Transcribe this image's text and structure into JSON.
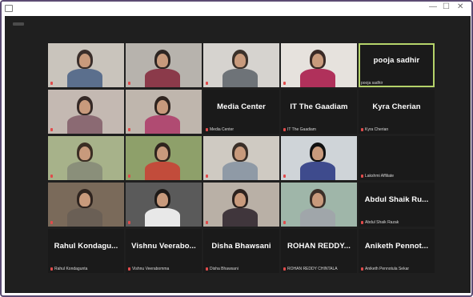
{
  "window": {
    "title": "",
    "controls": [
      "—",
      "☐",
      "✕"
    ],
    "accent": "#5b4a72",
    "background": "#1f1f1f"
  },
  "participants": [
    {
      "name": "",
      "label": "",
      "video": true,
      "muted": true
    },
    {
      "name": "",
      "label": "",
      "video": true,
      "muted": true
    },
    {
      "name": "",
      "label": "",
      "video": true,
      "muted": true
    },
    {
      "name": "",
      "label": "",
      "video": true,
      "muted": true
    },
    {
      "name": "pooja sadhir",
      "label": "pooja sadhir",
      "video": false,
      "muted": false,
      "active": true
    },
    {
      "name": "",
      "label": "",
      "video": true,
      "muted": true
    },
    {
      "name": "",
      "label": "",
      "video": true,
      "muted": true
    },
    {
      "name": "Media Center",
      "label": "Media Center",
      "video": false,
      "muted": true
    },
    {
      "name": "IT The Gaadiam",
      "label": "IT The Gaadiam",
      "video": false,
      "muted": true
    },
    {
      "name": "Kyra Cherian",
      "label": "Kyra Cherian",
      "video": false,
      "muted": true
    },
    {
      "name": "",
      "label": "",
      "video": true,
      "muted": true
    },
    {
      "name": "",
      "label": "",
      "video": true,
      "muted": true
    },
    {
      "name": "",
      "label": "",
      "video": true,
      "muted": true
    },
    {
      "name": "",
      "label": "",
      "video": true,
      "muted": true
    },
    {
      "name": "",
      "label": "Lakshmi Affiliate",
      "video": false,
      "muted": true
    },
    {
      "name": "",
      "label": "",
      "video": true,
      "muted": true
    },
    {
      "name": "",
      "label": "",
      "video": true,
      "muted": true
    },
    {
      "name": "",
      "label": "",
      "video": true,
      "muted": true
    },
    {
      "name": "",
      "label": "",
      "video": true,
      "muted": true
    },
    {
      "name": "Abdul Shaik Ru...",
      "label": "Abdul Shaik Razak",
      "video": false,
      "muted": true
    },
    {
      "name": "Rahul Kondagu...",
      "label": "Rahul Kondagunta",
      "video": false,
      "muted": true
    },
    {
      "name": "Vishnu Veerabo...",
      "label": "Vishnu Veerabomma",
      "video": false,
      "muted": true
    },
    {
      "name": "Disha Bhawsani",
      "label": "Disha Bhawsani",
      "video": false,
      "muted": true
    },
    {
      "name": "ROHAN REDDY...",
      "label": "ROHAN REDDY CHINTALA",
      "video": false,
      "muted": true
    },
    {
      "name": "Aniketh Pennot...",
      "label": "Aniketh Pennotula Sekar",
      "video": false,
      "muted": true
    }
  ],
  "colors": {
    "tile_bg": "#1a1a1a",
    "active_border": "#b5d36a",
    "muted_icon": "#e04b4b"
  }
}
